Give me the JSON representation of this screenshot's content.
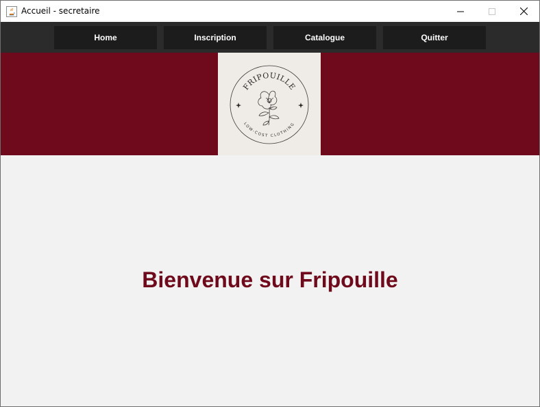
{
  "window": {
    "title": "Accueil - secretaire",
    "app_icon": "java-icon"
  },
  "nav": {
    "home_label": "Home",
    "inscription_label": "Inscription",
    "catalogue_label": "Catalogue",
    "quitter_label": "Quitter"
  },
  "banner": {
    "logo": {
      "brand": "FRIPOUILLE",
      "tagline": "LOW-COST CLOTHING"
    }
  },
  "main": {
    "welcome_text": "Bienvenue sur Fripouille"
  },
  "colors": {
    "brand": "#6e0a1b",
    "navbar": "#2b2b2b",
    "nav_button": "#1c1c1c",
    "logo_bg": "#efebe6",
    "content_bg": "#f2f2f2"
  }
}
